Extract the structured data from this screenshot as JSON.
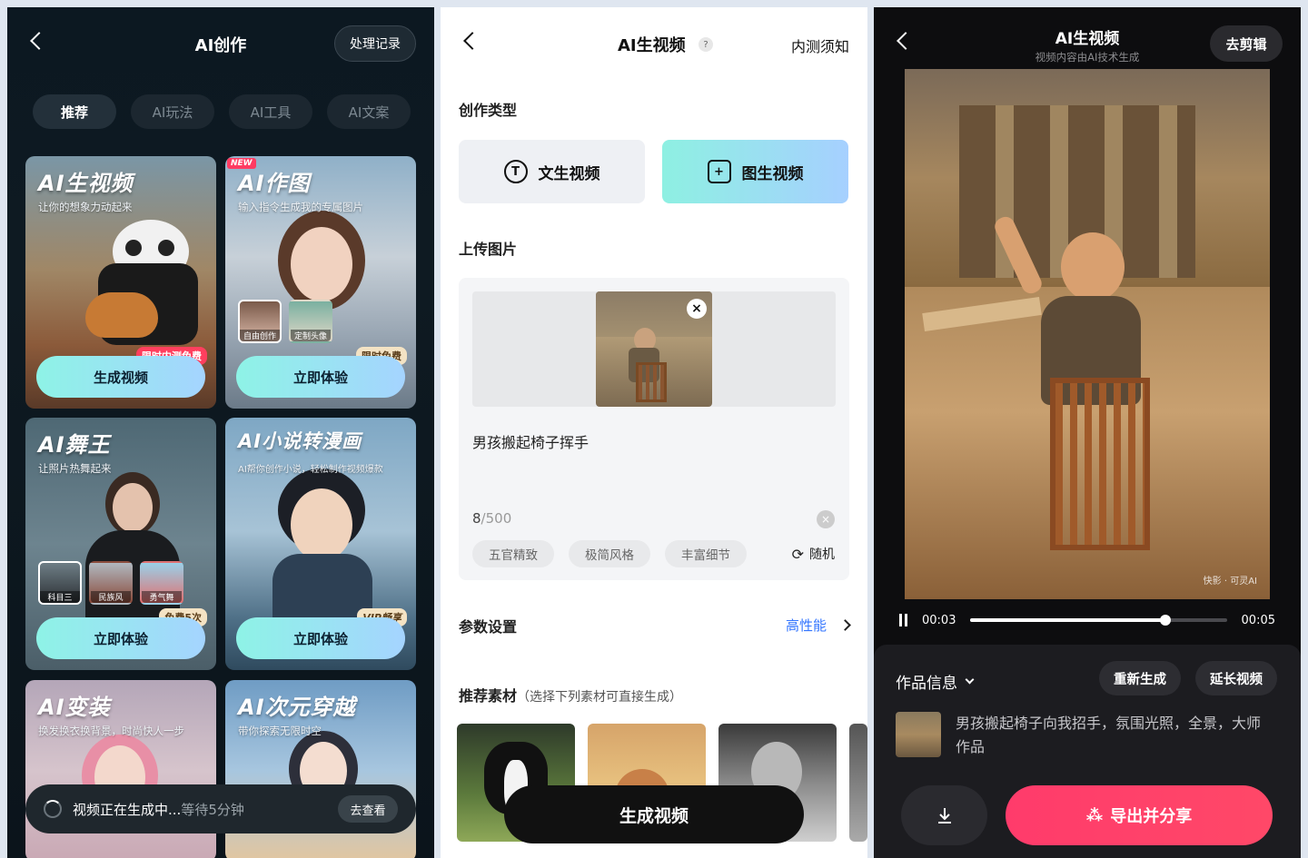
{
  "panel1": {
    "title": "AI创作",
    "history_label": "处理记录",
    "tabs": [
      "推荐",
      "AI玩法",
      "AI工具",
      "AI文案"
    ],
    "cards": [
      {
        "title": "AI生视频",
        "subtitle": "让你的想象力动起来",
        "button": "生成视频",
        "badge": "限时内测免费"
      },
      {
        "title": "AI作图",
        "subtitle": "输入指令生成我的专属图片",
        "button": "立即体验",
        "badge": "限时免费",
        "new_tag": "NEW",
        "thumbs": [
          "自由创作",
          "定制头像"
        ]
      },
      {
        "title": "AI舞王",
        "subtitle": "让照片热舞起来",
        "button": "立即体验",
        "badge": "免费5次",
        "thumbs": [
          "科目三",
          "民族风",
          "勇气舞"
        ]
      },
      {
        "title": "AI小说转漫画",
        "subtitle": "AI帮你创作小说，轻松制作视频爆款",
        "button": "立即体验",
        "badge": "VIP畅享"
      },
      {
        "title": "AI变装",
        "subtitle": "换发换衣换背景，时尚快人一步"
      },
      {
        "title": "AI次元穿越",
        "subtitle": "带你探索无限时空"
      }
    ],
    "toast": {
      "message": "视频正在生成中...",
      "wait": "等待5分钟",
      "action": "去查看"
    }
  },
  "panel2": {
    "title": "AI生视频",
    "help": "?",
    "notice": "内测须知",
    "section_type": "创作类型",
    "type_options": [
      {
        "label": "文生视频",
        "icon": "text-to-video-icon",
        "icon_glyph": "T"
      },
      {
        "label": "图生视频",
        "icon": "image-to-video-icon",
        "icon_glyph": "+"
      }
    ],
    "section_upload": "上传图片",
    "prompt_text": "男孩搬起椅子挥手",
    "char_count": "8",
    "char_limit": "/500",
    "style_chips": [
      "五官精致",
      "极简风格",
      "丰富细节"
    ],
    "random_label": "随机",
    "section_params": "参数设置",
    "params_value": "高性能",
    "section_recommend": "推荐素材",
    "recommend_note": "（选择下列素材可直接生成）",
    "generate_button": "生成视频"
  },
  "panel3": {
    "title": "AI生视频",
    "subtitle": "视频内容由AI技术生成",
    "edit_label": "去剪辑",
    "watermark": "快影  ·  可灵AI",
    "time_current": "00:03",
    "time_total": "00:05",
    "progress": 0.76,
    "info_title": "作品信息",
    "regenerate_label": "重新生成",
    "extend_label": "延长视频",
    "prompt_full": "男孩搬起椅子向我招手，氛围光照，全景，大师作品",
    "export_label": "导出并分享"
  },
  "colors": {
    "accent_blue": "#3476ff",
    "export_pink": "#ff3b6b",
    "badge_red": "#ff3f5e",
    "gradient_teal": "#8ef3e6"
  }
}
